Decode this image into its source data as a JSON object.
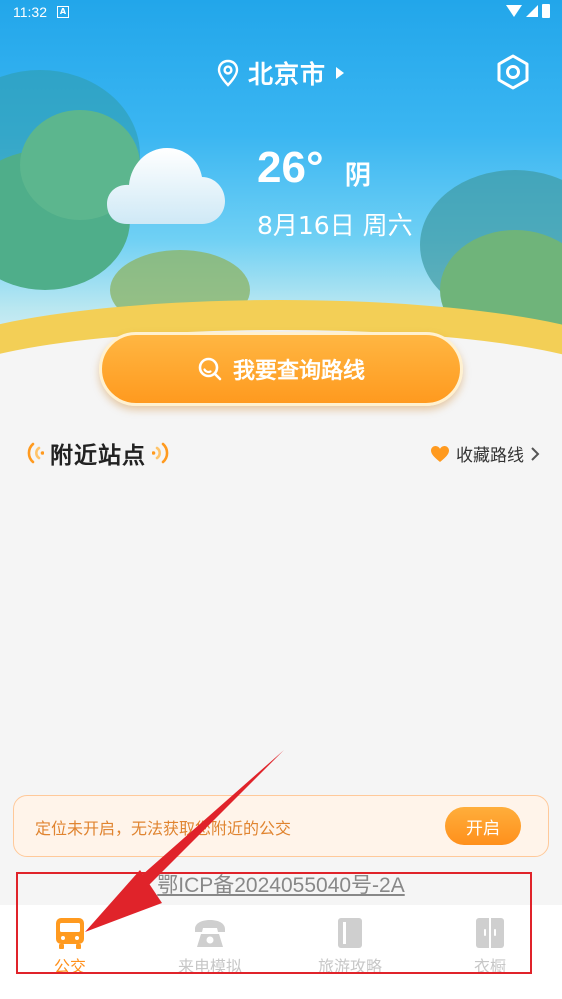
{
  "status_bar": {
    "time": "11:32",
    "app_badge": "A"
  },
  "header": {
    "city": "北京市"
  },
  "weather": {
    "temperature": "26°",
    "condition": "阴",
    "date": "8月16日 周六"
  },
  "search": {
    "label": "我要查询路线"
  },
  "nearby": {
    "title": "附近站点",
    "favorites_label": "收藏路线"
  },
  "location_notice": {
    "text": "定位未开启，无法获取您附近的公交",
    "button_label": "开启"
  },
  "icp": {
    "text": "鄂ICP备2024055040号-2A"
  },
  "tabbar": {
    "tabs": [
      {
        "label": "公交",
        "active": true
      },
      {
        "label": "来电模拟",
        "active": false
      },
      {
        "label": "旅游攻略",
        "active": false
      },
      {
        "label": "衣橱",
        "active": false
      }
    ]
  },
  "colors": {
    "accent": "#ff9a1f",
    "sky": "#2aa9ec",
    "annotation": "#e0232a"
  }
}
